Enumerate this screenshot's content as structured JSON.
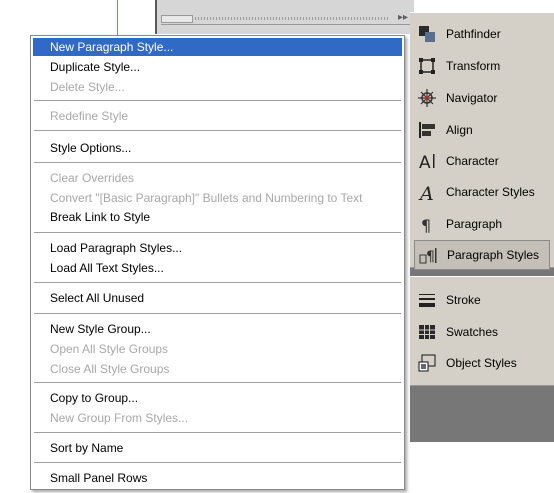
{
  "menu": {
    "items": [
      {
        "label": "New Paragraph Style...",
        "enabled": true,
        "highlighted": true
      },
      {
        "label": "Duplicate Style...",
        "enabled": true
      },
      {
        "label": "Delete Style...",
        "enabled": false
      },
      {
        "label": "Redefine Style",
        "enabled": false
      },
      {
        "label": "Style Options...",
        "enabled": true
      },
      {
        "label": "Clear Overrides",
        "enabled": false
      },
      {
        "label": "Convert \"[Basic Paragraph]\" Bullets and Numbering to Text",
        "enabled": false
      },
      {
        "label": "Break Link to Style",
        "enabled": true
      },
      {
        "label": "Load Paragraph Styles...",
        "enabled": true
      },
      {
        "label": "Load All Text Styles...",
        "enabled": true
      },
      {
        "label": "Select All Unused",
        "enabled": true
      },
      {
        "label": "New Style Group...",
        "enabled": true
      },
      {
        "label": "Open All Style Groups",
        "enabled": false
      },
      {
        "label": "Close All Style Groups",
        "enabled": false
      },
      {
        "label": "Copy to Group...",
        "enabled": true
      },
      {
        "label": "New Group From Styles...",
        "enabled": false
      },
      {
        "label": "Sort by Name",
        "enabled": true
      },
      {
        "label": "Small Panel Rows",
        "enabled": true
      }
    ]
  },
  "dock": {
    "group1": [
      {
        "label": "Pathfinder",
        "icon": "pathfinder-icon"
      },
      {
        "label": "Transform",
        "icon": "transform-icon"
      },
      {
        "label": "Navigator",
        "icon": "navigator-icon"
      },
      {
        "label": "Align",
        "icon": "align-icon"
      },
      {
        "label": "Character",
        "icon": "character-icon"
      },
      {
        "label": "Character Styles",
        "icon": "character-styles-icon"
      },
      {
        "label": "Paragraph",
        "icon": "paragraph-icon"
      },
      {
        "label": "Paragraph Styles",
        "icon": "paragraph-styles-icon",
        "active": true
      }
    ],
    "group2": [
      {
        "label": "Stroke",
        "icon": "stroke-icon"
      },
      {
        "label": "Swatches",
        "icon": "swatches-icon"
      },
      {
        "label": "Object Styles",
        "icon": "object-styles-icon"
      }
    ]
  },
  "colors": {
    "highlight": "#316ac5",
    "dock_bg": "#d4d0c8",
    "dock_well": "#777777",
    "disabled_text": "#a8a8a8"
  }
}
